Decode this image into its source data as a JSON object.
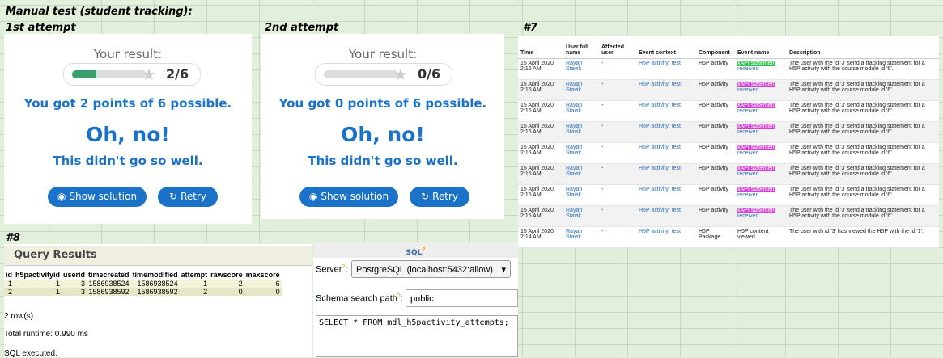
{
  "sheet": {
    "title": "Manual test (student tracking):",
    "attempt1_label": "1st attempt",
    "attempt2_label": "2nd attempt",
    "section7_label": "#7",
    "section8_label": "#8"
  },
  "attempts": [
    {
      "your_result": "Your result:",
      "score": "2/6",
      "progress": 0.33,
      "points_text": "You got 2 points of 6 possible.",
      "headline": "Oh, no!",
      "subline": "This didn't go so well.",
      "show_solution": "Show solution",
      "retry": "Retry"
    },
    {
      "your_result": "Your result:",
      "score": "0/6",
      "progress": 0,
      "points_text": "You got 0 points of 6 possible.",
      "headline": "Oh, no!",
      "subline": "This didn't go so well.",
      "show_solution": "Show solution",
      "retry": "Retry"
    }
  ],
  "log": {
    "columns": [
      "Time",
      "User full name",
      "Affected user",
      "Event context",
      "Component",
      "Event name",
      "Description"
    ],
    "rows": [
      {
        "time": "15 April 2020, 2:16 AM",
        "user": "Rayan Stavik",
        "affected": "-",
        "context": "H5P activity: test",
        "component": "H5P activity",
        "event": "xAPI statement",
        "event2": "received",
        "tag": "green",
        "desc": "The user with the id '3' send a tracking statement for a H5P activity with the course module id '6'."
      },
      {
        "time": "15 April 2020, 2:16 AM",
        "user": "Rayan Stavik",
        "affected": "-",
        "context": "H5P activity: test",
        "component": "H5P activity",
        "event": "xAPI statement",
        "event2": "received",
        "tag": "magenta",
        "desc": "The user with the id '3' send a tracking statement for a H5P activity with the course module id '6'."
      },
      {
        "time": "15 April 2020, 2:16 AM",
        "user": "Rayan Stavik",
        "affected": "-",
        "context": "H5P activity: test",
        "component": "H5P activity",
        "event": "xAPI statement",
        "event2": "received",
        "tag": "magenta",
        "desc": "The user with the id '3' send a tracking statement for a H5P activity with the course module id '6'."
      },
      {
        "time": "15 April 2020, 2:16 AM",
        "user": "Rayan Stavik",
        "affected": "-",
        "context": "H5P activity: test",
        "component": "H5P activity",
        "event": "xAPI statement",
        "event2": "received",
        "tag": "magenta",
        "desc": "The user with the id '3' send a tracking statement for a H5P activity with the course module id '6'."
      },
      {
        "time": "15 April 2020, 2:15 AM",
        "user": "Rayan Stavik",
        "affected": "-",
        "context": "H5P activity: test",
        "component": "H5P activity",
        "event": "xAPI statement",
        "event2": "received",
        "tag": "magenta",
        "desc": "The user with the id '3' send a tracking statement for a H5P activity with the course module id '6'."
      },
      {
        "time": "15 April 2020, 2:15 AM",
        "user": "Rayan Stavik",
        "affected": "-",
        "context": "H5P activity: test",
        "component": "H5P activity",
        "event": "xAPI statement",
        "event2": "received",
        "tag": "magenta",
        "desc": "The user with the id '3' send a tracking statement for a H5P activity with the course module id '6'."
      },
      {
        "time": "15 April 2020, 2:15 AM",
        "user": "Rayan Stavik",
        "affected": "-",
        "context": "H5P activity: test",
        "component": "H5P activity",
        "event": "xAPI statement",
        "event2": "received",
        "tag": "magenta",
        "desc": "The user with the id '3' send a tracking statement for a H5P activity with the course module id '6'."
      },
      {
        "time": "15 April 2020, 2:15 AM",
        "user": "Rayan Stavik",
        "affected": "-",
        "context": "H5P activity: test",
        "component": "H5P activity",
        "event": "xAPI statement",
        "event2": "received",
        "tag": "magenta",
        "desc": "The user with the id '3' send a tracking statement for a H5P activity with the course module id '6'."
      },
      {
        "time": "15 April 2020, 2:14 AM",
        "user": "Rayan Stavik",
        "affected": "-",
        "context": "H5P activity: test",
        "component": "H5P Package",
        "event": "H5P content",
        "event2": "viewed",
        "tag": "none",
        "desc": "The user with id '3' has viewed the H5P with the id '1'."
      }
    ]
  },
  "query": {
    "title": "Query Results",
    "columns": [
      "id",
      "h5pactivityid",
      "userid",
      "timecreated",
      "timemodified",
      "attempt",
      "rawscore",
      "maxscore"
    ],
    "rows": [
      [
        "1",
        "1",
        "3",
        "1586938524",
        "1586938524",
        "1",
        "2",
        "6"
      ],
      [
        "2",
        "1",
        "3",
        "1586938592",
        "1586938592",
        "2",
        "0",
        "0"
      ]
    ],
    "row_count": "2 row(s)",
    "runtime": "Total runtime: 0.990 ms",
    "cut_text": "SQL executed."
  },
  "sql": {
    "title": "SQL",
    "server_label": "Server",
    "server_value": "PostgreSQL (localhost:5432:allow)",
    "schema_label": "Schema search path",
    "schema_value": "public",
    "query_text": "SELECT * FROM mdl_h5pactivity_attempts;"
  },
  "colors": {
    "accent": "#1a73c8",
    "progress": "#3aa06b",
    "tag_green": "#2fbf4a",
    "tag_magenta": "#d63fd6"
  }
}
